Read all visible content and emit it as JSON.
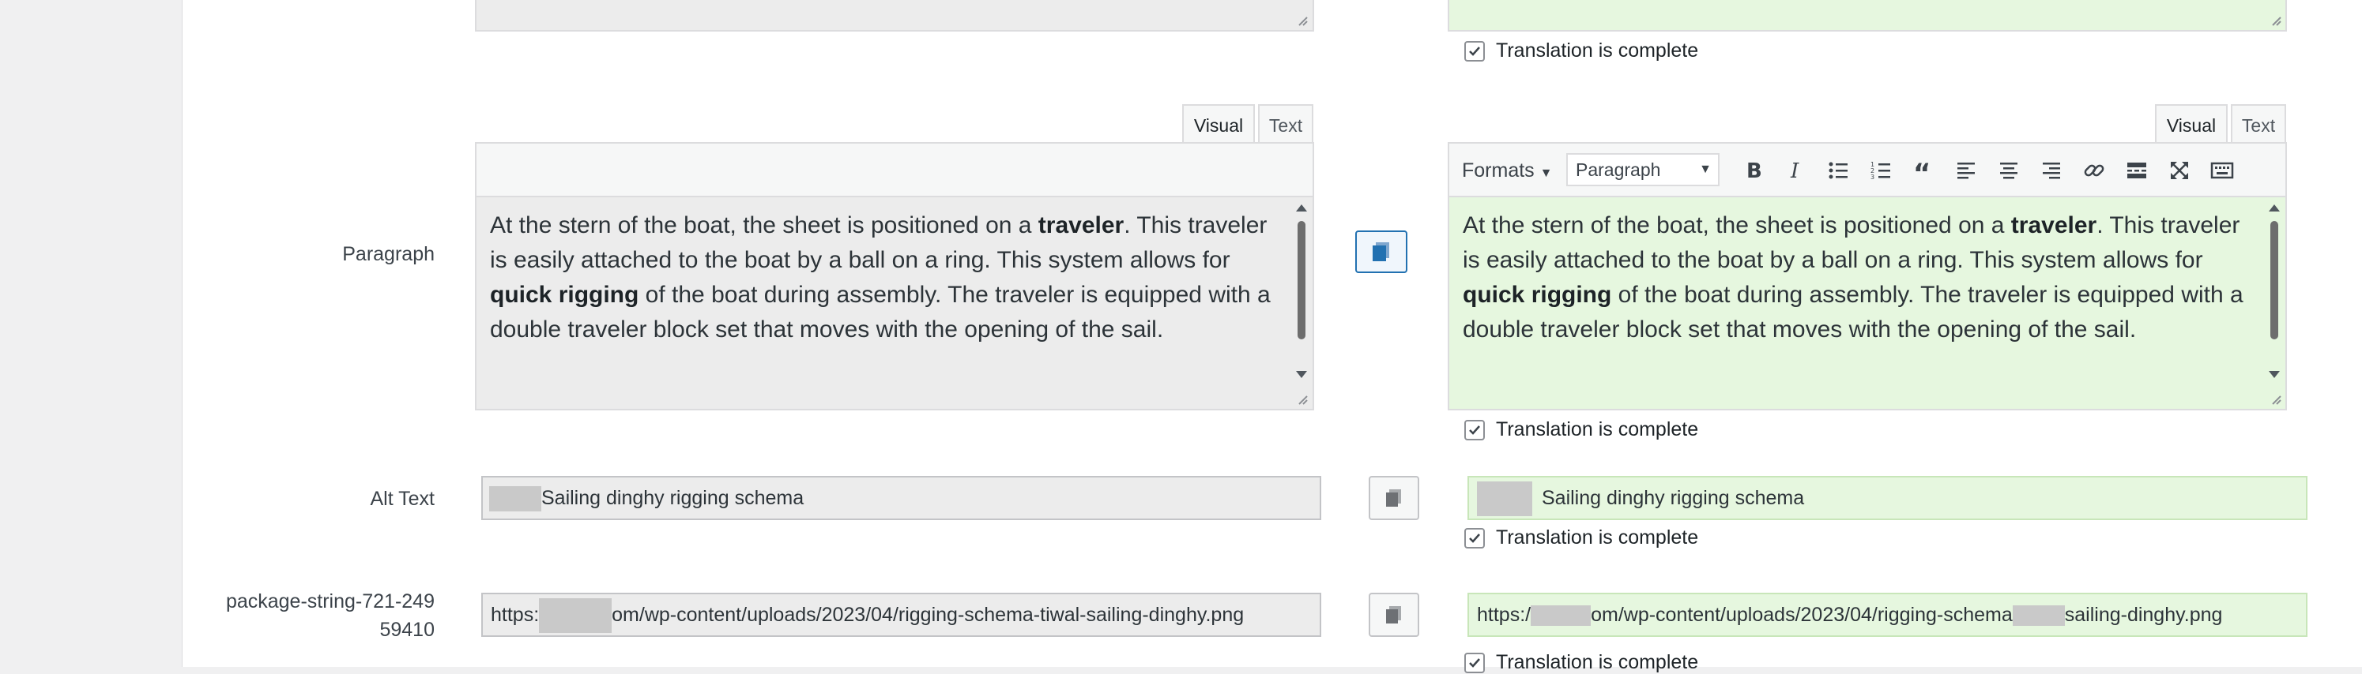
{
  "fields": {
    "paragraph": {
      "label": "Paragraph",
      "tabs": {
        "visual": "Visual",
        "text": "Text"
      },
      "toolbar": {
        "formats": "Formats",
        "paragraph_select": "Paragraph"
      },
      "content": {
        "t1": "At the stern of the boat, the sheet is positioned on a ",
        "b1": "traveler",
        "t2": ". This traveler is easily attached to the boat by a ball on a ring. This system allows for ",
        "b2": "quick rigging",
        "t3": " of the boat during assembly. The traveler is equipped with a double traveler block set that moves with the opening of the sail."
      }
    },
    "alt_text": {
      "label": "Alt Text",
      "original_value": "Sailing dinghy rigging schema",
      "translation_value": "Sailing dinghy rigging schema"
    },
    "package_string": {
      "label_line1": "package-string-721-249",
      "label_line2": "59410",
      "original_prefix": "https:",
      "original_suffix": "om/wp-content/uploads/2023/04/rigging-schema-tiwal-sailing-dinghy.png",
      "translation_prefix": "https:/",
      "translation_middle": "om/wp-content/uploads/2023/04/rigging-schema",
      "translation_suffix": "sailing-dinghy.png"
    }
  },
  "translation_complete_label": "Translation is complete",
  "icons": [
    "resize-handle-icon",
    "copy-icon",
    "bold-icon",
    "italic-icon",
    "bullet-list-icon",
    "numbered-list-icon",
    "blockquote-icon",
    "align-left-icon",
    "align-center-icon",
    "align-right-icon",
    "link-icon",
    "read-more-icon",
    "fullscreen-icon",
    "keyboard-icon",
    "checkmark-icon"
  ],
  "colors": {
    "translation_bg": "#e6f7df",
    "original_bg": "#ececec",
    "accent": "#2271b1"
  }
}
